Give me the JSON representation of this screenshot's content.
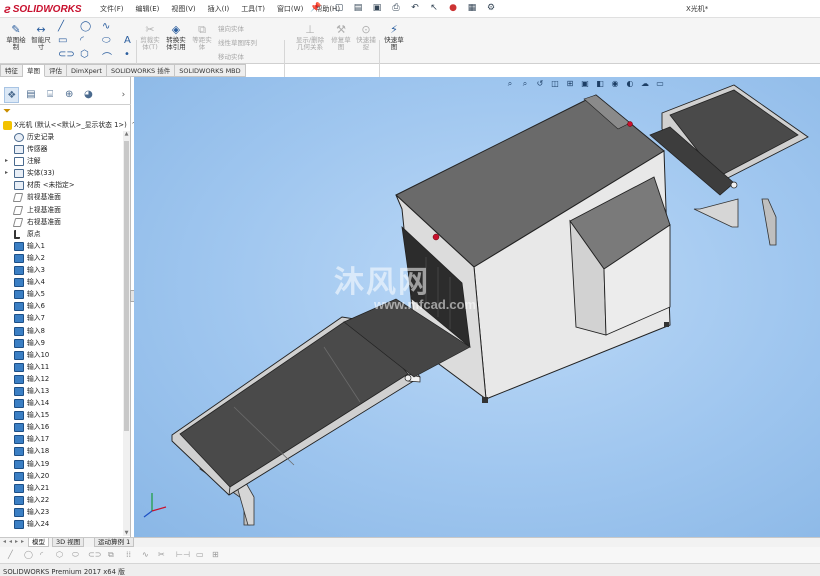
{
  "app": {
    "brand": "SOLIDWORKS",
    "document_title": "X光机*"
  },
  "menu": {
    "items": [
      "文件(F)",
      "编辑(E)",
      "视图(V)",
      "插入(I)",
      "工具(T)",
      "窗口(W)",
      "帮助(H)"
    ]
  },
  "ribbon": {
    "sketch": "草图绘制",
    "smart_dim": "智能尺寸",
    "trim": "剪裁实体(T)",
    "convert": "转换实体引用",
    "offset": "等距实体",
    "mirror": "镜向实体",
    "linear_pattern": "线性草图阵列",
    "move": "移动实体",
    "display_delete": "显示/删除几何关系",
    "repair": "修复草图",
    "quick_snap": "快速捕捉",
    "instant2d": "快速草图"
  },
  "tabs": [
    "特征",
    "草图",
    "评估",
    "DimXpert",
    "SOLIDWORKS 插件",
    "SOLIDWORKS MBD"
  ],
  "active_tab": "草图",
  "tree": {
    "root": "X光机 (默认<<默认>_显示状态 1>)",
    "items": [
      {
        "label": "历史记录",
        "icon": "history-icon"
      },
      {
        "label": "传感器",
        "icon": "sensor-icon"
      },
      {
        "label": "注解",
        "icon": "annotation-icon"
      },
      {
        "label": "实体(33)",
        "icon": "solid-bodies-icon"
      },
      {
        "label": "材质 <未指定>",
        "icon": "material-icon"
      },
      {
        "label": "前视基准面",
        "icon": "plane-icon"
      },
      {
        "label": "上视基准面",
        "icon": "plane-icon"
      },
      {
        "label": "右视基准面",
        "icon": "plane-icon"
      },
      {
        "label": "原点",
        "icon": "origin-icon"
      },
      {
        "label": "输入1",
        "icon": "imported-body-icon"
      },
      {
        "label": "输入2",
        "icon": "imported-body-icon"
      },
      {
        "label": "输入3",
        "icon": "imported-body-icon"
      },
      {
        "label": "输入4",
        "icon": "imported-body-icon"
      },
      {
        "label": "输入5",
        "icon": "imported-body-icon"
      },
      {
        "label": "输入6",
        "icon": "imported-body-icon"
      },
      {
        "label": "输入7",
        "icon": "imported-body-icon"
      },
      {
        "label": "输入8",
        "icon": "imported-body-icon"
      },
      {
        "label": "输入9",
        "icon": "imported-body-icon"
      },
      {
        "label": "输入10",
        "icon": "imported-body-icon"
      },
      {
        "label": "输入11",
        "icon": "imported-body-icon"
      },
      {
        "label": "输入12",
        "icon": "imported-body-icon"
      },
      {
        "label": "输入13",
        "icon": "imported-body-icon"
      },
      {
        "label": "输入14",
        "icon": "imported-body-icon"
      },
      {
        "label": "输入15",
        "icon": "imported-body-icon"
      },
      {
        "label": "输入16",
        "icon": "imported-body-icon"
      },
      {
        "label": "输入17",
        "icon": "imported-body-icon"
      },
      {
        "label": "输入18",
        "icon": "imported-body-icon"
      },
      {
        "label": "输入19",
        "icon": "imported-body-icon"
      },
      {
        "label": "输入20",
        "icon": "imported-body-icon"
      },
      {
        "label": "输入21",
        "icon": "imported-body-icon"
      },
      {
        "label": "输入22",
        "icon": "imported-body-icon"
      },
      {
        "label": "输入23",
        "icon": "imported-body-icon"
      },
      {
        "label": "输入24",
        "icon": "imported-body-icon"
      }
    ]
  },
  "watermark": {
    "brand_cn": "沐风网",
    "url": "www.mfcad.com"
  },
  "bottom_tabs": [
    "模型",
    "3D 视图",
    "运动算例 1"
  ],
  "status": "SOLIDWORKS Premium 2017 x64 版",
  "colors": {
    "viewport_bg": "#9fc6ef",
    "brand_red": "#c8102e",
    "belt_dark": "#4b4b4b",
    "body_gray": "#e6e6e6"
  }
}
